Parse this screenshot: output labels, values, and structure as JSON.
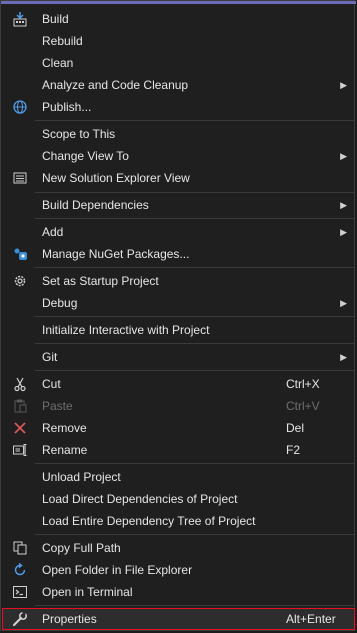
{
  "menu": {
    "items": [
      {
        "label": "Build",
        "shortcut": "",
        "submenu": false,
        "icon": "build-icon"
      },
      {
        "label": "Rebuild",
        "shortcut": "",
        "submenu": false,
        "icon": ""
      },
      {
        "label": "Clean",
        "shortcut": "",
        "submenu": false,
        "icon": ""
      },
      {
        "label": "Analyze and Code Cleanup",
        "shortcut": "",
        "submenu": true,
        "icon": ""
      },
      {
        "label": "Publish...",
        "shortcut": "",
        "submenu": false,
        "icon": "globe-icon"
      },
      {
        "label": "Scope to This",
        "shortcut": "",
        "submenu": false,
        "icon": ""
      },
      {
        "label": "Change View To",
        "shortcut": "",
        "submenu": true,
        "icon": ""
      },
      {
        "label": "New Solution Explorer View",
        "shortcut": "",
        "submenu": false,
        "icon": "solution-explorer-icon"
      },
      {
        "label": "Build Dependencies",
        "shortcut": "",
        "submenu": true,
        "icon": ""
      },
      {
        "label": "Add",
        "shortcut": "",
        "submenu": true,
        "icon": ""
      },
      {
        "label": "Manage NuGet Packages...",
        "shortcut": "",
        "submenu": false,
        "icon": "nuget-icon"
      },
      {
        "label": "Set as Startup Project",
        "shortcut": "",
        "submenu": false,
        "icon": "gear-icon"
      },
      {
        "label": "Debug",
        "shortcut": "",
        "submenu": true,
        "icon": ""
      },
      {
        "label": "Initialize Interactive with Project",
        "shortcut": "",
        "submenu": false,
        "icon": ""
      },
      {
        "label": "Git",
        "shortcut": "",
        "submenu": true,
        "icon": ""
      },
      {
        "label": "Cut",
        "shortcut": "Ctrl+X",
        "submenu": false,
        "icon": "scissors-icon"
      },
      {
        "label": "Paste",
        "shortcut": "Ctrl+V",
        "submenu": false,
        "icon": "paste-icon",
        "disabled": true
      },
      {
        "label": "Remove",
        "shortcut": "Del",
        "submenu": false,
        "icon": "remove-icon"
      },
      {
        "label": "Rename",
        "shortcut": "F2",
        "submenu": false,
        "icon": "rename-icon"
      },
      {
        "label": "Unload Project",
        "shortcut": "",
        "submenu": false,
        "icon": ""
      },
      {
        "label": "Load Direct Dependencies of Project",
        "shortcut": "",
        "submenu": false,
        "icon": ""
      },
      {
        "label": "Load Entire Dependency Tree of Project",
        "shortcut": "",
        "submenu": false,
        "icon": ""
      },
      {
        "label": "Copy Full Path",
        "shortcut": "",
        "submenu": false,
        "icon": "copy-icon"
      },
      {
        "label": "Open Folder in File Explorer",
        "shortcut": "",
        "submenu": false,
        "icon": "refresh-arrow-icon"
      },
      {
        "label": "Open in Terminal",
        "shortcut": "",
        "submenu": false,
        "icon": "terminal-icon"
      },
      {
        "label": "Properties",
        "shortcut": "Alt+Enter",
        "submenu": false,
        "icon": "wrench-icon",
        "highlighted": true
      }
    ],
    "submenu_arrow": "▶"
  }
}
